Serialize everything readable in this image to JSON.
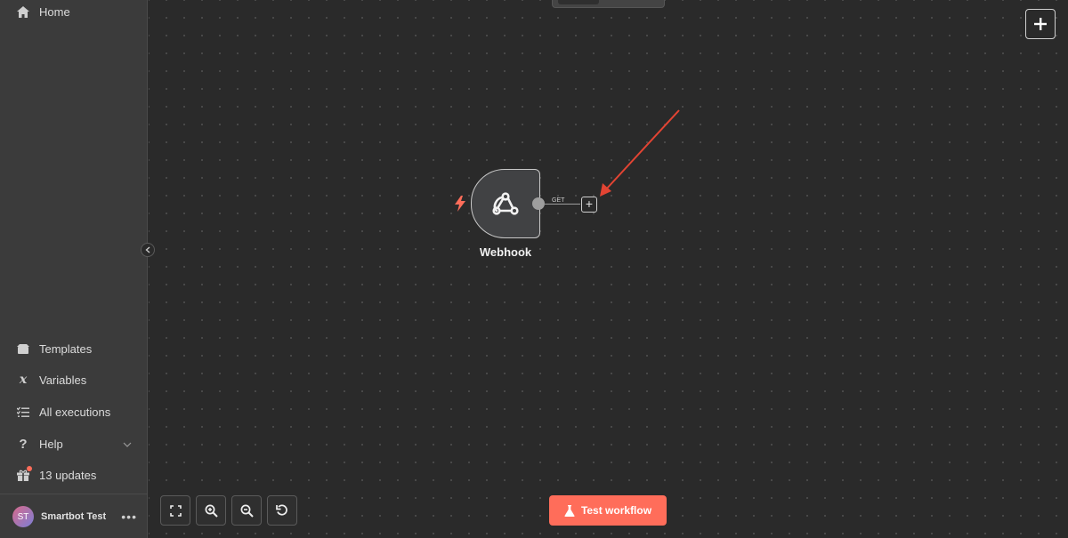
{
  "sidebar": {
    "home": {
      "label": "Home",
      "icon": "home-icon"
    },
    "templates": {
      "label": "Templates",
      "icon": "box-icon"
    },
    "variables": {
      "label": "Variables",
      "icon": "variable-x-icon"
    },
    "executions": {
      "label": "All executions",
      "icon": "list-check-icon"
    },
    "help": {
      "label": "Help",
      "icon": "question-icon"
    },
    "updates": {
      "label": "13 updates",
      "icon": "gift-icon"
    },
    "user": {
      "initials": "ST",
      "name": "Smartbot Test"
    }
  },
  "canvas": {
    "node": {
      "label": "Webhook",
      "icon": "webhook-icon"
    },
    "connection_label": "GET"
  },
  "toolbar": {
    "test_workflow_label": "Test workflow",
    "accent_color": "#ff6d5a"
  }
}
